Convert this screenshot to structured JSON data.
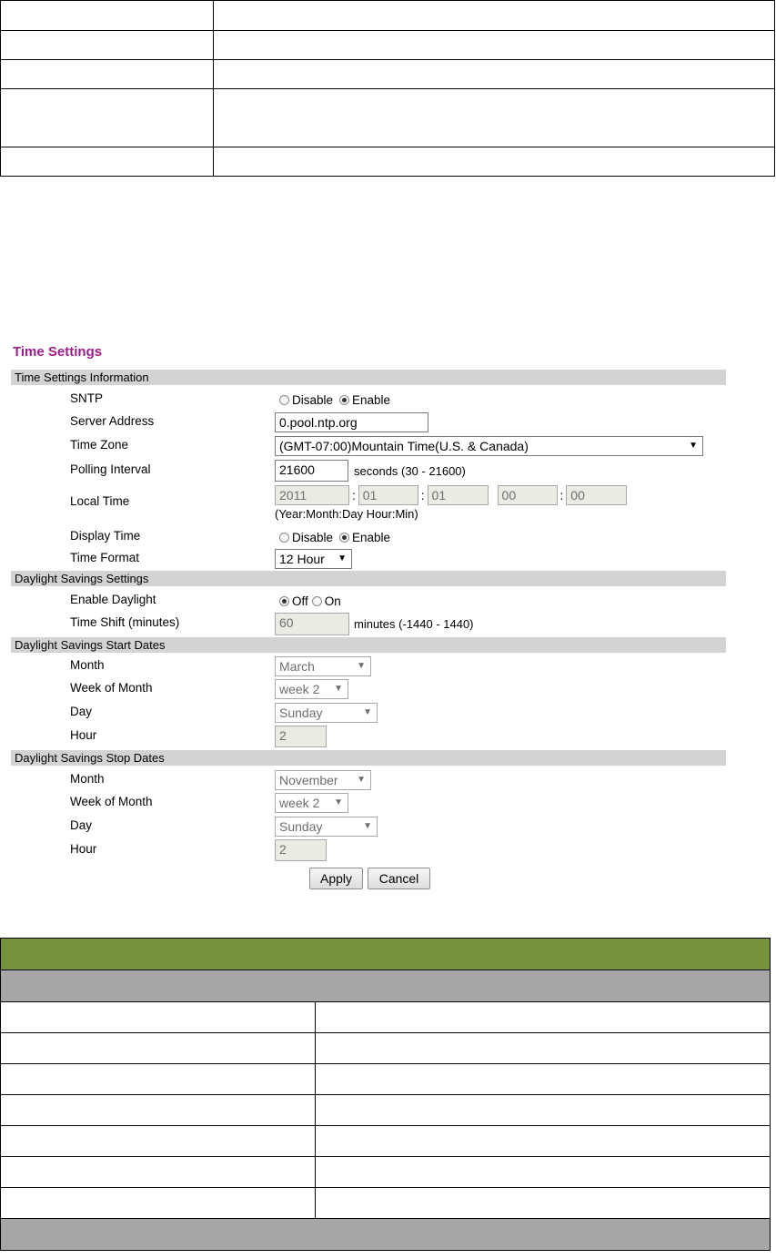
{
  "form": {
    "title": "Time Settings",
    "sections": {
      "info": "Time Settings Information",
      "dst": "Daylight Savings Settings",
      "start": "Daylight Savings Start Dates",
      "stop": "Daylight Savings Stop Dates"
    },
    "sntp": {
      "label": "SNTP",
      "disable": "Disable",
      "enable": "Enable",
      "selected": "Enable"
    },
    "server_address": {
      "label": "Server Address",
      "value": "0.pool.ntp.org"
    },
    "time_zone": {
      "label": "Time Zone",
      "value": "(GMT-07:00)Mountain Time(U.S. & Canada)"
    },
    "polling_interval": {
      "label": "Polling Interval",
      "value": "21600",
      "unit": "seconds (30 - 21600)"
    },
    "local_time": {
      "label": "Local Time",
      "year": "2011",
      "month": "01",
      "day": "01",
      "hour": "00",
      "min": "00",
      "colon": ":",
      "hint": "(Year:Month:Day Hour:Min)"
    },
    "display_time": {
      "label": "Display Time",
      "disable": "Disable",
      "enable": "Enable",
      "selected": "Enable"
    },
    "time_format": {
      "label": "Time Format",
      "value": "12 Hour"
    },
    "enable_daylight": {
      "label": "Enable Daylight",
      "off": "Off",
      "on": "On",
      "selected": "Off"
    },
    "time_shift": {
      "label": "Time Shift (minutes)",
      "value": "60",
      "unit": "minutes (-1440 - 1440)"
    },
    "start": {
      "month_label": "Month",
      "month": "March",
      "week_label": "Week of Month",
      "week": "week 2",
      "day_label": "Day",
      "day": "Sunday",
      "hour_label": "Hour",
      "hour": "2"
    },
    "stop": {
      "month_label": "Month",
      "month": "November",
      "week_label": "Week of Month",
      "week": "week 2",
      "day_label": "Day",
      "day": "Sunday",
      "hour_label": "Hour",
      "hour": "2"
    },
    "apply": "Apply",
    "cancel": "Cancel"
  },
  "icons": {
    "dropdown": "dropdown-arrow-icon"
  },
  "colors": {
    "title": "#9b1e8c",
    "section_bar": "#d3d3d3",
    "table_header": "#76923c",
    "table_subheader": "#a6a6a6"
  }
}
